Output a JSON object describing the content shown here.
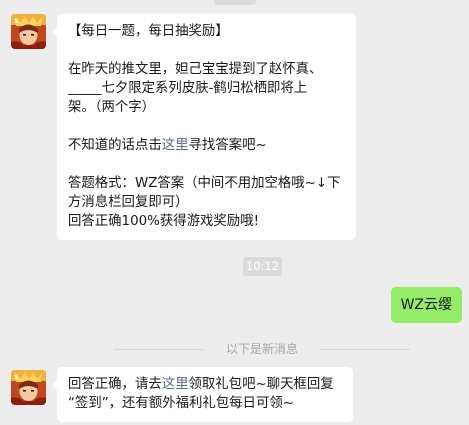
{
  "messages": [
    {
      "title": "【每日一题，每日抽奖励】",
      "question_line1": "在昨天的推文里，妲己宝宝提到了赵怀真、",
      "question_line2": "_____七夕限定系列皮肤-鹤归松栖即将上",
      "question_line3": "架。（两个字）",
      "hint_prefix": "不知道的话点击",
      "hint_link": "这里",
      "hint_suffix": "寻找答案吧~",
      "format_line1": "答题格式：WZ答案（中间不用加空格哦~↓下",
      "format_line2": "方消息栏回复即可）",
      "reward_line": "回答正确100%获得游戏奖励哦!"
    },
    {
      "time": "10:12"
    },
    {
      "reply": "WZ云缨"
    },
    {
      "new_messages_divider": "以下是新消息"
    },
    {
      "answer_prefix": "回答正确，请去",
      "answer_link": "这里",
      "answer_suffix": "领取礼包吧~聊天框回复",
      "answer_line2": "“签到”，还有额外福利礼包每日可领~"
    }
  ],
  "avatar_icon": "game-character-avatar-icon",
  "colors": {
    "background": "#ededed",
    "incoming_bubble": "#ffffff",
    "outgoing_bubble": "#95ec69",
    "link": "#576b95"
  }
}
